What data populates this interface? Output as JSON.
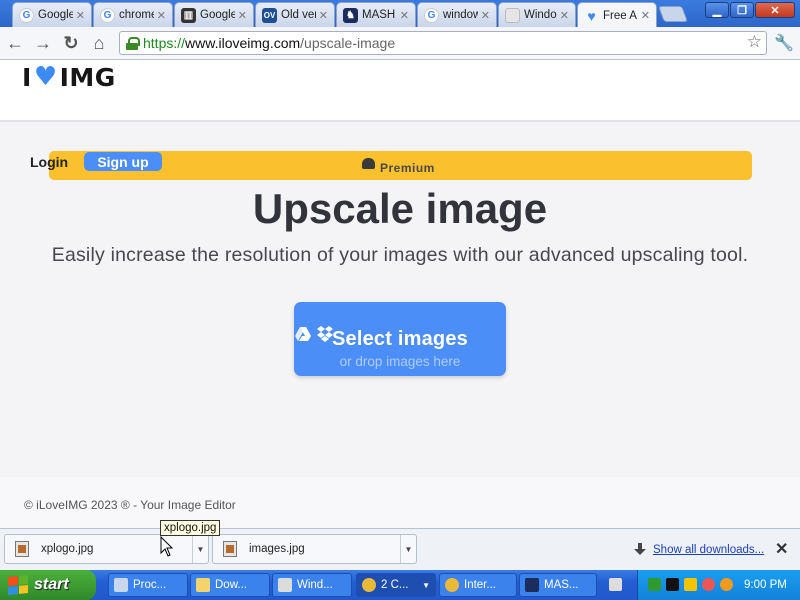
{
  "browser": {
    "tabs": [
      {
        "title": "Google",
        "icon": "google-icon"
      },
      {
        "title": "chrome",
        "icon": "google-icon"
      },
      {
        "title": "Google",
        "icon": "bank-icon"
      },
      {
        "title": "Old ver",
        "icon": "ov-icon",
        "icon_text": "OV"
      },
      {
        "title": "MASH",
        "icon": "mash-icon"
      },
      {
        "title": "window",
        "icon": "google-icon"
      },
      {
        "title": "Windo",
        "icon": "windows-icon"
      },
      {
        "title": "Free A",
        "icon": "heart-icon",
        "active": true
      }
    ],
    "url": {
      "scheme": "https://",
      "host": "www.iloveimg.com",
      "path": "/upscale-image"
    }
  },
  "site": {
    "logo": {
      "left": "I",
      "right": "IMG"
    },
    "login": "Login",
    "signup": "Sign up",
    "premium": "Premium",
    "title": "Upscale image",
    "subtitle": "Easily increase the resolution of your images with our advanced upscaling tool.",
    "select_button": "Select images",
    "drop_hint": "or drop images here",
    "footer": "© iLoveIMG 2023 ® - Your Image Editor",
    "accent": "#4c8ef7",
    "premium_color": "#fbc02d"
  },
  "downloads": {
    "items": [
      {
        "name": "xplogo.jpg"
      },
      {
        "name": "images.jpg"
      }
    ],
    "show_all": "Show all downloads...",
    "tooltip": "xplogo.jpg"
  },
  "taskbar": {
    "start": "start",
    "tasks": [
      {
        "label": "Proc...",
        "icon": "monitor-icon"
      },
      {
        "label": "Dow...",
        "icon": "folder-icon"
      },
      {
        "label": "Wind...",
        "icon": "computer-icon"
      },
      {
        "label": "2 C...",
        "icon": "chrome-icon",
        "pressed": true
      },
      {
        "label": "Inter...",
        "icon": "chrome-icon"
      },
      {
        "label": "MAS...",
        "icon": "mash-icon"
      }
    ],
    "clock": "9:00 PM"
  }
}
